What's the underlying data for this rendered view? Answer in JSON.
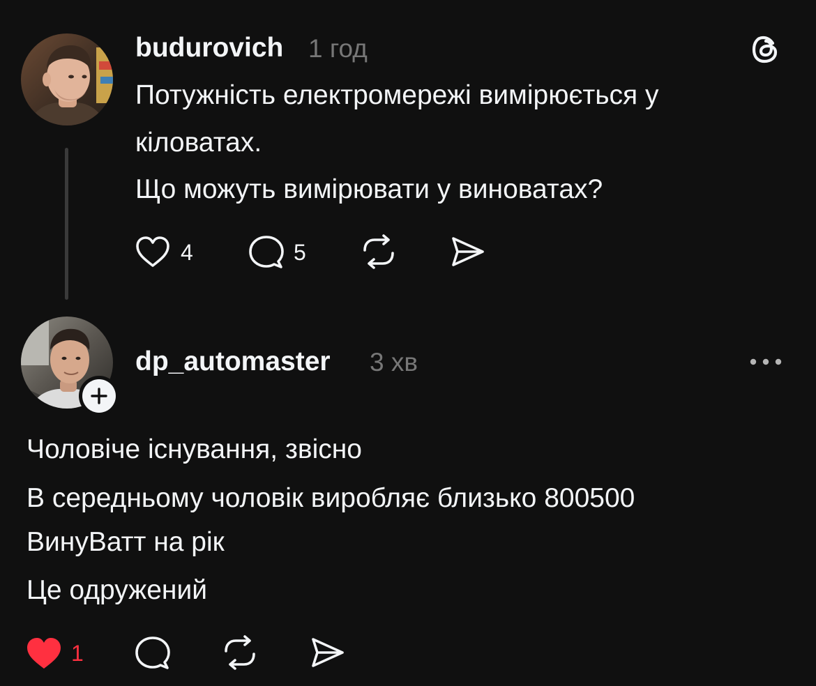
{
  "posts": [
    {
      "username": "budurovich",
      "time": "1 год",
      "lines": [
        "Потужність електромережі вимірюється у",
        "кіловатах.",
        "Що можуть вимірювати у виноватах?"
      ],
      "likes": "4",
      "replies": "5",
      "liked": false
    },
    {
      "username": "dp_automaster",
      "time": "3 хв",
      "lines": [
        "Чоловіче існування, звісно",
        "В середньому чоловік виробляє близько 800500",
        "ВинуВатт на рік",
        "Це одружений"
      ],
      "likes": "1",
      "replies": "",
      "liked": true
    }
  ],
  "icons": {
    "header_right": "threads-logo-icon",
    "more": "more-horizontal-icon",
    "follow": "plus-icon",
    "like": "heart-icon",
    "reply": "comment-bubble-icon",
    "repost": "repost-icon",
    "share": "send-icon"
  },
  "colors": {
    "background": "#101010",
    "text": "#f3f5f7",
    "muted": "#777777",
    "like_active": "#ff3040",
    "thread_line": "#3a3a3a"
  }
}
